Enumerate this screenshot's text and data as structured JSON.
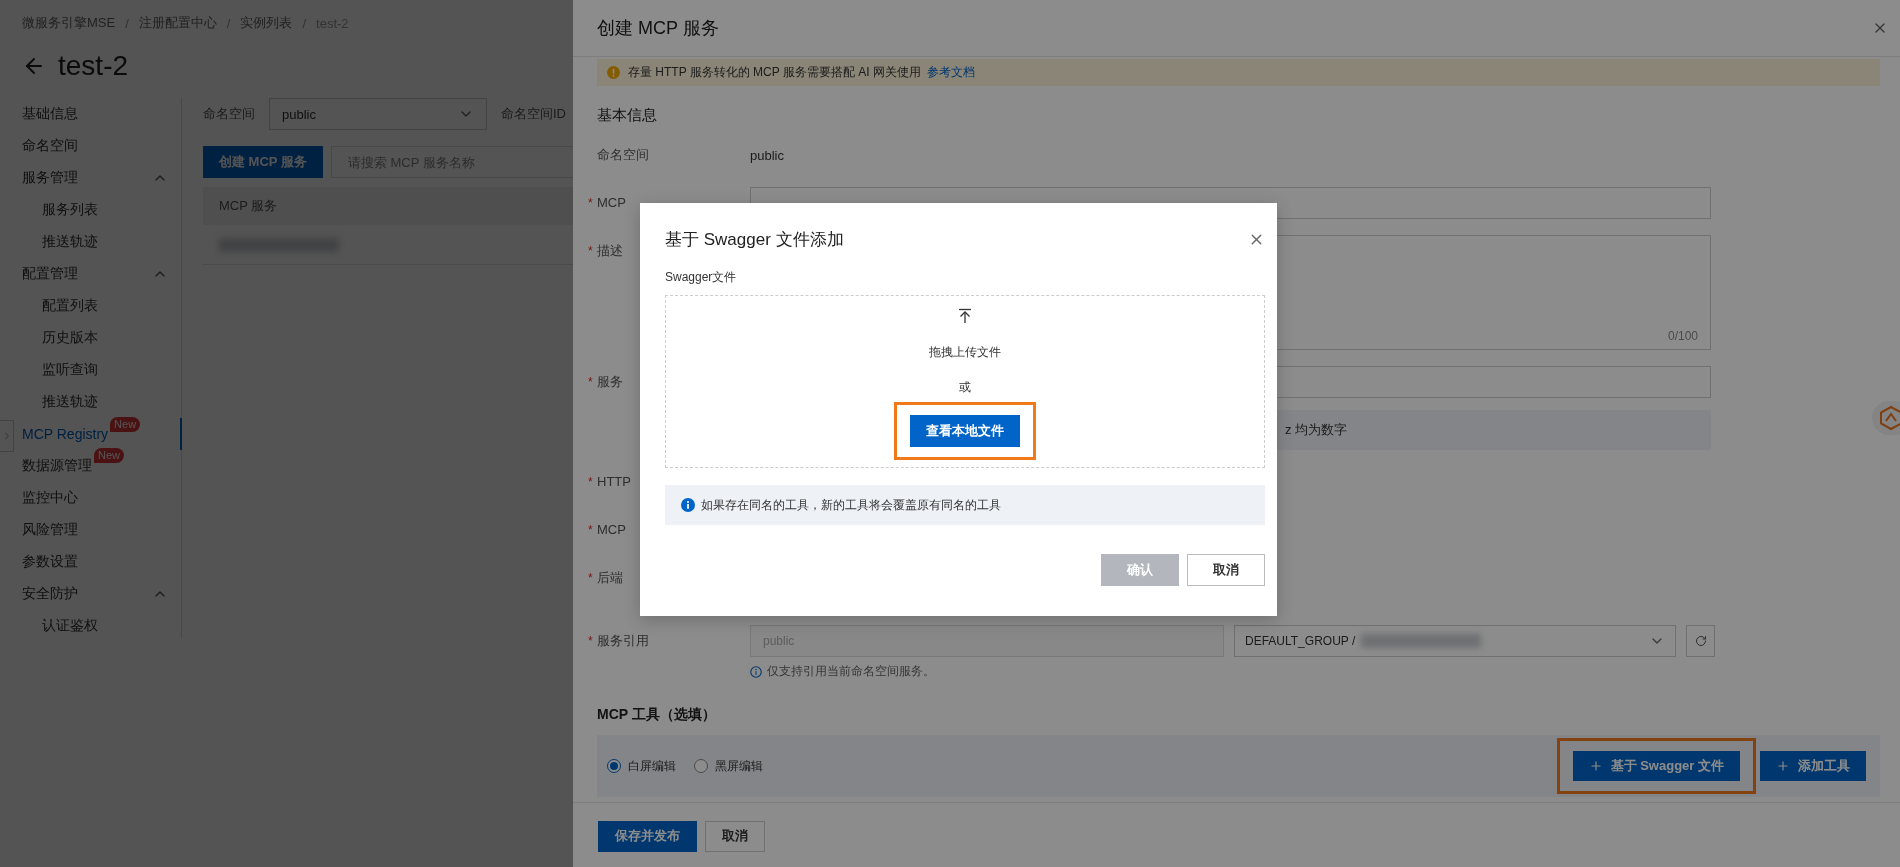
{
  "breadcrumbs": [
    "微服务引擎MSE",
    "注册配置中心",
    "实例列表",
    "test-2"
  ],
  "breadcrumb_separator": "/",
  "page_title": "test-2",
  "sidebar": {
    "items": [
      {
        "label": "基础信息",
        "selected": false
      },
      {
        "label": "命名空间",
        "selected": false
      },
      {
        "label": "服务管理",
        "selected": false,
        "expanded": true,
        "children": [
          {
            "label": "服务列表",
            "selected": false
          },
          {
            "label": "推送轨迹",
            "selected": false
          }
        ]
      },
      {
        "label": "配置管理",
        "selected": false,
        "expanded": true,
        "children": [
          {
            "label": "配置列表",
            "selected": false
          },
          {
            "label": "历史版本",
            "selected": false
          },
          {
            "label": "监听查询",
            "selected": false
          },
          {
            "label": "推送轨迹",
            "selected": false
          }
        ]
      },
      {
        "label": "MCP Registry",
        "selected": true,
        "badge": "New"
      },
      {
        "label": "数据源管理",
        "selected": false,
        "badge": "New"
      },
      {
        "label": "监控中心",
        "selected": false
      },
      {
        "label": "风险管理",
        "selected": false
      },
      {
        "label": "参数设置",
        "selected": false
      },
      {
        "label": "安全防护",
        "selected": false,
        "expanded": true,
        "children": [
          {
            "label": "认证鉴权",
            "selected": false
          }
        ]
      }
    ]
  },
  "toolbar": {
    "namespace_label": "命名空间",
    "namespace_value": "public",
    "namespace_id_label": "命名空间ID",
    "create_button": "创建 MCP 服务",
    "search_placeholder": "请搜索 MCP 服务名称"
  },
  "table": {
    "columns": [
      "MCP 服务"
    ],
    "rows": [
      {
        "kind": "redacted"
      }
    ]
  },
  "drawer": {
    "title": "创建 MCP 服务",
    "required_mark": "*",
    "alert": {
      "text": "存量 HTTP 服务转化的 MCP 服务需要搭配 AI 网关使用",
      "link": "参考文档"
    },
    "section_title": "基本信息",
    "form_rows": [
      {
        "kind": "text",
        "label": "命名空间",
        "required": false,
        "value": "public"
      },
      {
        "kind": "input",
        "label": "MCP",
        "required": true
      },
      {
        "kind": "textarea",
        "label": "描述",
        "required": true,
        "counter": "0/100"
      },
      {
        "kind": "input",
        "label": "服务",
        "required": true,
        "hint": "z 均为数字"
      },
      {
        "kind": "label",
        "label": "HTTP",
        "required": true
      },
      {
        "kind": "label",
        "label": "MCP",
        "required": true
      },
      {
        "kind": "label",
        "label": "后端",
        "required": true
      }
    ],
    "service_ref": {
      "label": "服务引用",
      "required": true,
      "namespace_value": "public",
      "namespace_disabled": true,
      "service_value": "DEFAULT_GROUP /",
      "help": "仅支持引用当前命名空间服务。"
    },
    "tools": {
      "title": "MCP 工具（选填）",
      "modes": [
        {
          "label": "白屏编辑",
          "selected": true
        },
        {
          "label": "黑屏编辑",
          "selected": false
        }
      ],
      "buttons": [
        {
          "label": "基于 Swagger 文件",
          "highlighted": true
        },
        {
          "label": "添加工具",
          "highlighted": false
        }
      ]
    },
    "footer_buttons": [
      {
        "label": "保存并发布",
        "kind": "primary"
      },
      {
        "label": "取消",
        "kind": "secondary"
      }
    ]
  },
  "modal": {
    "title": "基于 Swagger 文件添加",
    "field_label": "Swagger文件",
    "dropzone": {
      "text": "拖拽上传文件",
      "or": "或",
      "button": {
        "label": "查看本地文件",
        "highlighted": true
      }
    },
    "notice": "如果存在同名的工具，新的工具将会覆盖原有同名的工具",
    "buttons": [
      {
        "label": "确认",
        "kind": "primary",
        "disabled": true
      },
      {
        "label": "取消",
        "kind": "secondary",
        "disabled": false
      }
    ]
  }
}
